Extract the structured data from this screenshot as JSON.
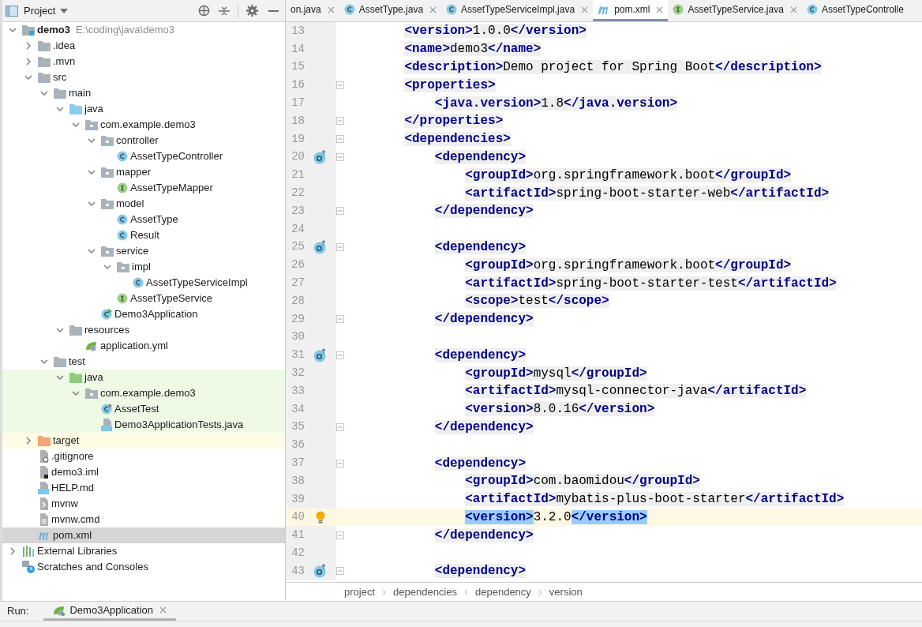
{
  "project_panel": {
    "title": "Project"
  },
  "tree": [
    {
      "label": "demo3",
      "kind": "module",
      "path": "E:\\coding\\java\\demo3",
      "expanded": true,
      "selected": false,
      "children": [
        {
          "label": ".idea",
          "kind": "folder",
          "expanded": false,
          "selected": false
        },
        {
          "label": ".mvn",
          "kind": "folder",
          "expanded": false,
          "selected": false
        },
        {
          "label": "src",
          "kind": "folder",
          "expanded": true,
          "selected": false,
          "children": [
            {
              "label": "main",
              "kind": "folder",
              "expanded": true,
              "selected": false,
              "children": [
                {
                  "label": "java",
                  "kind": "source-folder",
                  "expanded": true,
                  "selected": false,
                  "children": [
                    {
                      "label": "com.example.demo3",
                      "kind": "package",
                      "expanded": true,
                      "selected": false,
                      "children": [
                        {
                          "label": "controller",
                          "kind": "package",
                          "expanded": true,
                          "selected": false,
                          "children": [
                            {
                              "label": "AssetTypeController",
                              "kind": "class",
                              "selected": false
                            }
                          ]
                        },
                        {
                          "label": "mapper",
                          "kind": "package",
                          "expanded": true,
                          "selected": false,
                          "children": [
                            {
                              "label": "AssetTypeMapper",
                              "kind": "interface",
                              "selected": false
                            }
                          ]
                        },
                        {
                          "label": "model",
                          "kind": "package",
                          "expanded": true,
                          "selected": false,
                          "children": [
                            {
                              "label": "AssetType",
                              "kind": "class",
                              "selected": false
                            },
                            {
                              "label": "Result",
                              "kind": "class",
                              "selected": false
                            }
                          ]
                        },
                        {
                          "label": "service",
                          "kind": "package",
                          "expanded": true,
                          "selected": false,
                          "children": [
                            {
                              "label": "impl",
                              "kind": "package",
                              "expanded": true,
                              "selected": false,
                              "children": [
                                {
                                  "label": "AssetTypeServiceImpl",
                                  "kind": "class",
                                  "selected": false
                                }
                              ]
                            },
                            {
                              "label": "AssetTypeService",
                              "kind": "interface",
                              "selected": false
                            }
                          ]
                        },
                        {
                          "label": "Demo3Application",
                          "kind": "app",
                          "selected": false
                        }
                      ]
                    }
                  ]
                },
                {
                  "label": "resources",
                  "kind": "resources",
                  "expanded": true,
                  "selected": false,
                  "children": [
                    {
                      "label": "application.yml",
                      "kind": "spring",
                      "selected": false
                    }
                  ]
                }
              ]
            },
            {
              "label": "test",
              "kind": "folder",
              "expanded": true,
              "selected": false,
              "children": [
                {
                  "label": "java",
                  "kind": "test-folder",
                  "expanded": true,
                  "selected": false,
                  "children": [
                    {
                      "label": "com.example.demo3",
                      "kind": "package",
                      "expanded": true,
                      "selected": false,
                      "children": [
                        {
                          "label": "AssetTest",
                          "kind": "test-class",
                          "selected": false
                        },
                        {
                          "label": "Demo3ApplicationTests.java",
                          "kind": "java-file",
                          "selected": false
                        }
                      ]
                    }
                  ]
                }
              ]
            }
          ]
        },
        {
          "label": "target",
          "kind": "excluded-folder",
          "expanded": false,
          "selected": false
        },
        {
          "label": ".gitignore",
          "kind": "ignore-file",
          "selected": false
        },
        {
          "label": "demo3.iml",
          "kind": "iml-file",
          "selected": false
        },
        {
          "label": "HELP.md",
          "kind": "md-file",
          "selected": false
        },
        {
          "label": "mvnw",
          "kind": "script-file",
          "selected": false
        },
        {
          "label": "mvnw.cmd",
          "kind": "text-file",
          "selected": false
        },
        {
          "label": "pom.xml",
          "kind": "maven",
          "selected": true
        }
      ]
    },
    {
      "label": "External Libraries",
      "kind": "libraries",
      "expanded": false,
      "selected": false
    },
    {
      "label": "Scratches and Consoles",
      "kind": "scratches",
      "selected": false
    }
  ],
  "editor_tabs": [
    {
      "label": "on.java",
      "kind": "none",
      "selected": false,
      "closable": true
    },
    {
      "label": "AssetType.java",
      "kind": "class",
      "selected": false,
      "closable": true
    },
    {
      "label": "AssetTypeServiceImpl.java",
      "kind": "class",
      "selected": false,
      "closable": true
    },
    {
      "label": "pom.xml",
      "kind": "maven",
      "selected": true,
      "closable": true
    },
    {
      "label": "AssetTypeService.java",
      "kind": "interface",
      "selected": false,
      "closable": true
    },
    {
      "label": "AssetTypeControlle",
      "kind": "class",
      "selected": false,
      "closable": false
    }
  ],
  "code_lines": [
    {
      "number": "13",
      "text": "    <version>1.0.0</version>"
    },
    {
      "number": "14",
      "text": "    <name>demo3</name>"
    },
    {
      "number": "15",
      "text": "    <description>Demo project for Spring Boot</description>"
    },
    {
      "number": "16",
      "text": "    <properties>",
      "fold": true
    },
    {
      "number": "17",
      "text": "        <java.version>1.8</java.version>"
    },
    {
      "number": "18",
      "text": "    </properties>",
      "fold": true
    },
    {
      "number": "19",
      "text": "    <dependencies>",
      "fold": true
    },
    {
      "number": "20",
      "text": "        <dependency>",
      "fold": true,
      "overrides": true
    },
    {
      "number": "21",
      "text": "            <groupId>org.springframework.boot</groupId>"
    },
    {
      "number": "22",
      "text": "            <artifactId>spring-boot-starter-web</artifactId>"
    },
    {
      "number": "23",
      "text": "        </dependency>",
      "fold": true
    },
    {
      "number": "24"
    },
    {
      "number": "25",
      "text": "        <dependency>",
      "fold": true,
      "overrides": true
    },
    {
      "number": "26",
      "text": "            <groupId>org.springframework.boot</groupId>"
    },
    {
      "number": "27",
      "text": "            <artifactId>spring-boot-starter-test</artifactId>"
    },
    {
      "number": "28",
      "text": "            <scope>test</scope>"
    },
    {
      "number": "29",
      "text": "        </dependency>",
      "fold": true
    },
    {
      "number": "30"
    },
    {
      "number": "31",
      "text": "        <dependency>",
      "fold": true,
      "overrides": true
    },
    {
      "number": "32",
      "text": "            <groupId>mysql</groupId>"
    },
    {
      "number": "33",
      "text": "            <artifactId>mysql-connector-java</artifactId>"
    },
    {
      "number": "34",
      "text": "            <version>8.0.16</version>"
    },
    {
      "number": "35",
      "text": "        </dependency>",
      "fold": true
    },
    {
      "number": "36"
    },
    {
      "number": "37",
      "text": "        <dependency>",
      "fold": true
    },
    {
      "number": "38",
      "text": "            <groupId>com.baomidou</groupId>"
    },
    {
      "number": "39",
      "text": "            <artifactId>mybatis-plus-boot-starter</artifactId>"
    },
    {
      "number": "40",
      "text": "            <version>3.2.0</version>",
      "intention": true,
      "current": true,
      "tags_matched": true
    },
    {
      "number": "41",
      "text": "        </dependency>",
      "fold": true
    },
    {
      "number": "42"
    },
    {
      "number": "43",
      "text": "        <dependency>",
      "fold": true,
      "overrides": true
    }
  ],
  "breadcrumbs": [
    "project",
    "dependencies",
    "dependency",
    "version"
  ],
  "run_bar": {
    "label": "Run:",
    "tabs": [
      {
        "label": "Demo3Application",
        "selected": true
      }
    ]
  }
}
